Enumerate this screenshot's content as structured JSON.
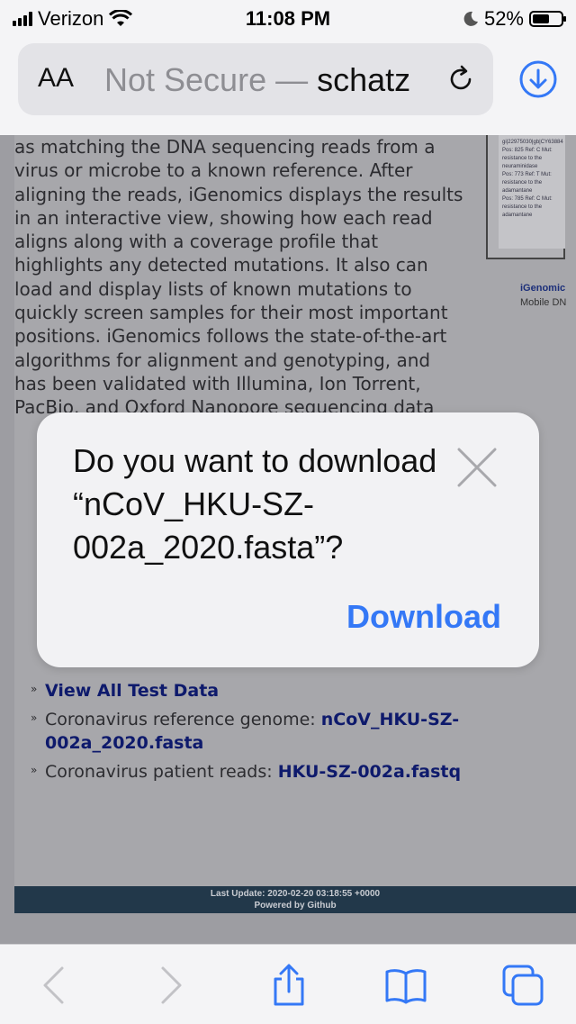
{
  "status_bar": {
    "carrier": "Verizon",
    "time": "11:08 PM",
    "battery": "52%"
  },
  "url_bar": {
    "aa_label": "AA",
    "not_secure": "Not Secure",
    "separator": " — ",
    "domain": "schatz"
  },
  "page": {
    "paragraph": "as matching the DNA sequencing reads from a virus or microbe to a known reference. After aligning the reads, iGenomics displays the results in an interactive view, showing how each read aligns along with a coverage profile that highlights any detected mutations. It also can load and display lists of known mutations to quickly screen samples for their most important positions. iGenomics follows the state-of-the-art algorithms for alignment and genotyping, and has been validated with Illumina, Ion Torrent, PacBio, and Oxford Nanopore sequencing data",
    "screenshot_lines": [
      "gi|22975030|gb|CY63884",
      "Pos: 825 Ref: C Mut:",
      "resistance to the neuraminidase",
      "Pos: 773 Ref: T Mut:",
      "resistance to the adamantane",
      "Pos: 785 Ref: C Mut:",
      "resistance to the adamantane"
    ],
    "caption_title": "iGenomic",
    "caption_sub": "Mobile DN",
    "links": [
      {
        "prefix": "",
        "link": "View All Test Data"
      },
      {
        "prefix": "Coronavirus reference genome: ",
        "link": "nCoV_HKU-SZ-002a_2020.fasta"
      },
      {
        "prefix": "Coronavirus patient reads: ",
        "link": "HKU-SZ-002a.fastq"
      }
    ],
    "footer_line1": "Last Update: 2020-02-20 03:18:55 +0000",
    "footer_line2": "Powered by Github"
  },
  "dialog": {
    "message": "Do you want to download “nCoV_HKU-SZ-002a_2020.fasta”?",
    "download_label": "Download"
  },
  "colors": {
    "accent": "#3478f6",
    "link": "#0e1a6c",
    "footer": "#22384a"
  }
}
